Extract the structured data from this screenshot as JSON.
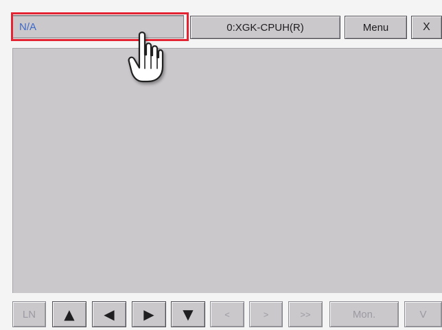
{
  "top_bar": {
    "status_value": "N/A",
    "device_label": "0:XGK-CPUH(R)",
    "menu_label": "Menu",
    "close_label": "X"
  },
  "bottom_bar": {
    "buttons": [
      {
        "label": "LN",
        "state": "disabled"
      },
      {
        "label": "▲",
        "icon": "triangle-up-icon",
        "state": "enabled"
      },
      {
        "label": "◀",
        "icon": "triangle-left-icon",
        "state": "enabled"
      },
      {
        "label": "▶",
        "icon": "triangle-right-icon",
        "state": "enabled"
      },
      {
        "label": "▼",
        "icon": "triangle-down-icon",
        "state": "enabled"
      },
      {
        "label": "<",
        "state": "disabled"
      },
      {
        "label": ">",
        "state": "disabled"
      },
      {
        "label": ">>",
        "state": "disabled"
      },
      {
        "label": "Mon.",
        "state": "disabled"
      },
      {
        "label": "V",
        "state": "disabled"
      }
    ]
  },
  "overlay": {
    "highlight_color": "#e32332",
    "cursor_icon": "hand-pointer-icon"
  }
}
